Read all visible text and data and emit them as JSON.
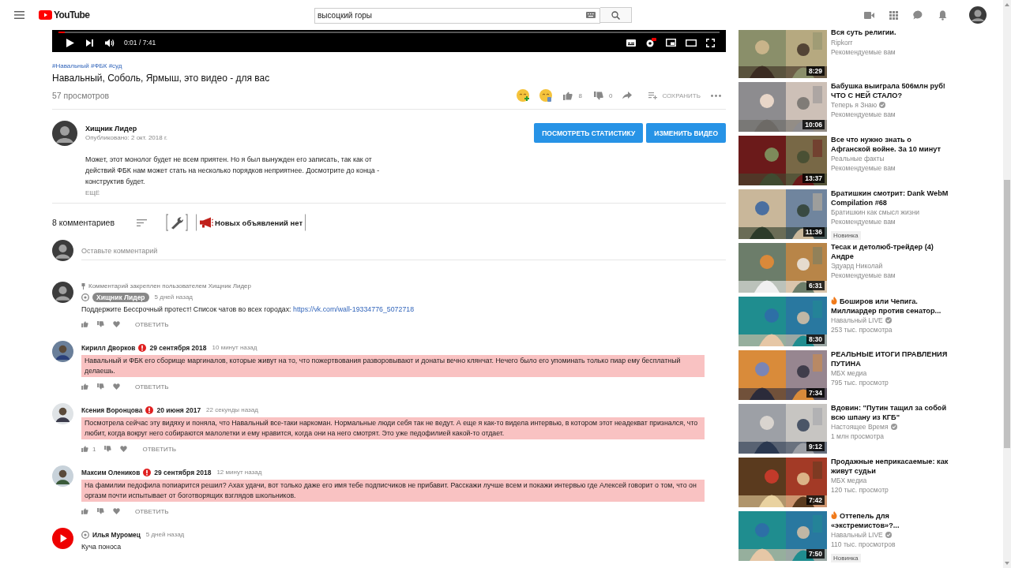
{
  "header": {
    "logo": "YouTube",
    "search": {
      "value": "высоцкий горы"
    }
  },
  "player": {
    "time": "0:01 / 7:41",
    "level": 0.01
  },
  "video": {
    "tags": "#Навальный #ФБК #суд",
    "title": "Навальный, Соболь, Ярмыш, это видео - для вас",
    "views": "57 просмотров",
    "likes": "8",
    "dislikes": "0",
    "save": "СОХРАНИТЬ"
  },
  "channel": {
    "name": "Хищник Лидер",
    "published": "Опубликовано: 2 окт. 2018 г.",
    "buttons": [
      "ПОСМОТРЕТЬ СТАТИСТИКУ",
      "ИЗМЕНИТЬ ВИДЕО"
    ],
    "description": "Может, этот монолог будет не всем приятен. Но я был вынужден его записать, так как от действий ФБК нам может стать на несколько порядков неприятнее. Досмотрите до конца - конструктив будет.",
    "more": "ЕЩЁ"
  },
  "comments_header": {
    "count": "8 комментариев",
    "announcement": "Новых объявлений нет"
  },
  "add_comment": {
    "placeholder": "Оставьте комментарий"
  },
  "comments": [
    {
      "kind": "pinned",
      "pinned_note": "Комментарий закреплен пользователем Хищник Лидер",
      "author": "Хищник Лидер",
      "time": "5 дней назад",
      "text": "Поддержите Бессрочный протест! Список чатов во всех городах: ",
      "link": "https://vk.com/wall-19334776_5072718",
      "reply": "ОТВЕТИТЬ"
    },
    {
      "kind": "flagged",
      "author": "Кирилл Дворков",
      "date": "29 сентября 2018",
      "time": "10 минут назад",
      "text": "Навальный и ФБК его сборище маргиналов, которые живут на то, что пожертвования разворовывают и донаты вечно клянчат. Нечего было его упоминать только пиар ему бесплатный делаешь.",
      "reply": "ОТВЕТИТЬ"
    },
    {
      "kind": "flagged",
      "author": "Ксения Воронцова",
      "date": "20 июня 2017",
      "time": "22 секунды назад",
      "text": "Посмотрела сейчас эту видяху и поняла, что Навальный все-таки наркоман. Нормальные люди себя так не ведут. А еще я как-то видела интервью, в котором этот неадекват признался, что любит, когда вокруг него собираются малолетки и ему нравится, когда они на него смотрят. Это уже педофилией какой-то отдает.",
      "likes": "1",
      "reply": "ОТВЕТИТЬ"
    },
    {
      "kind": "flagged",
      "author": "Максим Олеников",
      "date": "29 сентября 2018",
      "time": "12 минут назад",
      "text": "На фамилии педофила попиарится решил? Ахах удачи, вот только даже его имя тебе подписчиков не прибавит. Расскажи лучше всем и покажи интервью где Алексей говорит о том, что он оргазм почти испытывает от боготворящих взглядов школьников.",
      "reply": "ОТВЕТИТЬ"
    },
    {
      "kind": "plain",
      "author": "Илья Муромец",
      "time": "5 дней назад",
      "text": "Куча поноса"
    }
  ],
  "sidebar": [
    {
      "title": "Вся суть религии.",
      "channel": "Ripkorr",
      "verified": false,
      "meta": "Рекомендуемые вам",
      "duration": "8:29",
      "hot": false
    },
    {
      "title": "Бабушка выиграла 506млн руб! ЧТО С НЕЙ СТАЛО?",
      "channel": "Теперь я Знаю",
      "verified": true,
      "meta": "Рекомендуемые вам",
      "duration": "10:06",
      "hot": false
    },
    {
      "title": "Все что нужно знать о Афганской войне. За 10 минут",
      "channel": "Реальные факты",
      "verified": false,
      "meta": "Рекомендуемые вам",
      "duration": "13:37",
      "hot": false
    },
    {
      "title": "Братишкин смотрит: Dank WebM Compilation #68",
      "channel": "Братишкин как смысл жизни",
      "verified": false,
      "meta": "Рекомендуемые вам",
      "badge": "Новинка",
      "duration": "11:36",
      "hot": false
    },
    {
      "title": "Тесак и детолюб-трейдер (4) Андре",
      "channel": "Эдуард Николай",
      "verified": false,
      "meta": "Рекомендуемые вам",
      "duration": "6:31",
      "hot": false
    },
    {
      "title": "Боширов или Чепига. Миллиардер против сенатор...",
      "channel": "Навальный LIVE",
      "verified": true,
      "meta": "253 тыс. просмотра",
      "duration": "8:30",
      "hot": true
    },
    {
      "title": "РЕАЛЬНЫЕ ИТОГИ ПРАВЛЕНИЯ ПУТИНА",
      "channel": "МБХ медиа",
      "verified": false,
      "meta": "795 тыс. просмотр",
      "duration": "7:34",
      "hot": false
    },
    {
      "title": "Вдовин: \"Путин тащил за собой всю шпану из КГБ\"",
      "channel": "Настоящее Время",
      "verified": true,
      "meta": "1 млн просмотра",
      "duration": "9:12",
      "hot": false
    },
    {
      "title": "Продажные неприкасаемые: как живут судьи",
      "channel": "МБХ медиа",
      "verified": false,
      "meta": "120 тыс. просмотр",
      "duration": "7:42",
      "hot": false
    },
    {
      "title": "Оттепель для «экстремистов»?...",
      "channel": "Навальный LIVE",
      "verified": true,
      "meta": "110 тыс. просмотров",
      "badge": "Новинка",
      "duration": "7:50",
      "hot": true
    }
  ]
}
